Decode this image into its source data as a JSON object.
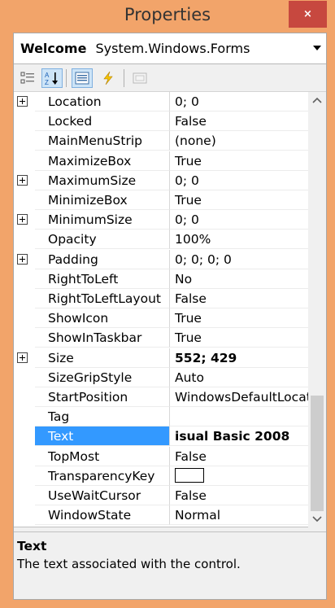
{
  "window": {
    "title": "Properties",
    "close_label": "×"
  },
  "object_selector": {
    "name": "Welcome",
    "type": "System.Windows.Forms"
  },
  "toolbar": {
    "buttons": [
      {
        "id": "categorized",
        "icon": "categorized-icon",
        "pressed": false
      },
      {
        "id": "alphabetical",
        "icon": "sort-alphabetical-icon",
        "pressed": true
      },
      {
        "id": "properties",
        "icon": "properties-icon",
        "pressed": true
      },
      {
        "id": "events",
        "icon": "lightning-events-icon",
        "pressed": false
      },
      {
        "id": "property-pages",
        "icon": "property-pages-icon",
        "pressed": false
      }
    ]
  },
  "properties": [
    {
      "name": "Location",
      "value": "0; 0",
      "expandable": true
    },
    {
      "name": "Locked",
      "value": "False"
    },
    {
      "name": "MainMenuStrip",
      "value": "(none)"
    },
    {
      "name": "MaximizeBox",
      "value": "True"
    },
    {
      "name": "MaximumSize",
      "value": "0; 0",
      "expandable": true
    },
    {
      "name": "MinimizeBox",
      "value": "True"
    },
    {
      "name": "MinimumSize",
      "value": "0; 0",
      "expandable": true
    },
    {
      "name": "Opacity",
      "value": "100%"
    },
    {
      "name": "Padding",
      "value": "0; 0; 0; 0",
      "expandable": true
    },
    {
      "name": "RightToLeft",
      "value": "No"
    },
    {
      "name": "RightToLeftLayout",
      "value": "False"
    },
    {
      "name": "ShowIcon",
      "value": "True"
    },
    {
      "name": "ShowInTaskbar",
      "value": "True"
    },
    {
      "name": "Size",
      "value": "552; 429",
      "expandable": true,
      "bold": true
    },
    {
      "name": "SizeGripStyle",
      "value": "Auto"
    },
    {
      "name": "StartPosition",
      "value": "WindowsDefaultLocation"
    },
    {
      "name": "Tag",
      "value": ""
    },
    {
      "name": "Text",
      "value": "isual Basic 2008",
      "selected": true,
      "bold": true
    },
    {
      "name": "TopMost",
      "value": "False"
    },
    {
      "name": "TransparencyKey",
      "value": "",
      "swatch": true
    },
    {
      "name": "UseWaitCursor",
      "value": "False"
    },
    {
      "name": "WindowState",
      "value": "Normal"
    }
  ],
  "description": {
    "title": "Text",
    "text": "The text associated with the control."
  },
  "colors": {
    "selection": "#3399ff",
    "window_frame": "#f2a46a",
    "close_button": "#c7483f"
  }
}
